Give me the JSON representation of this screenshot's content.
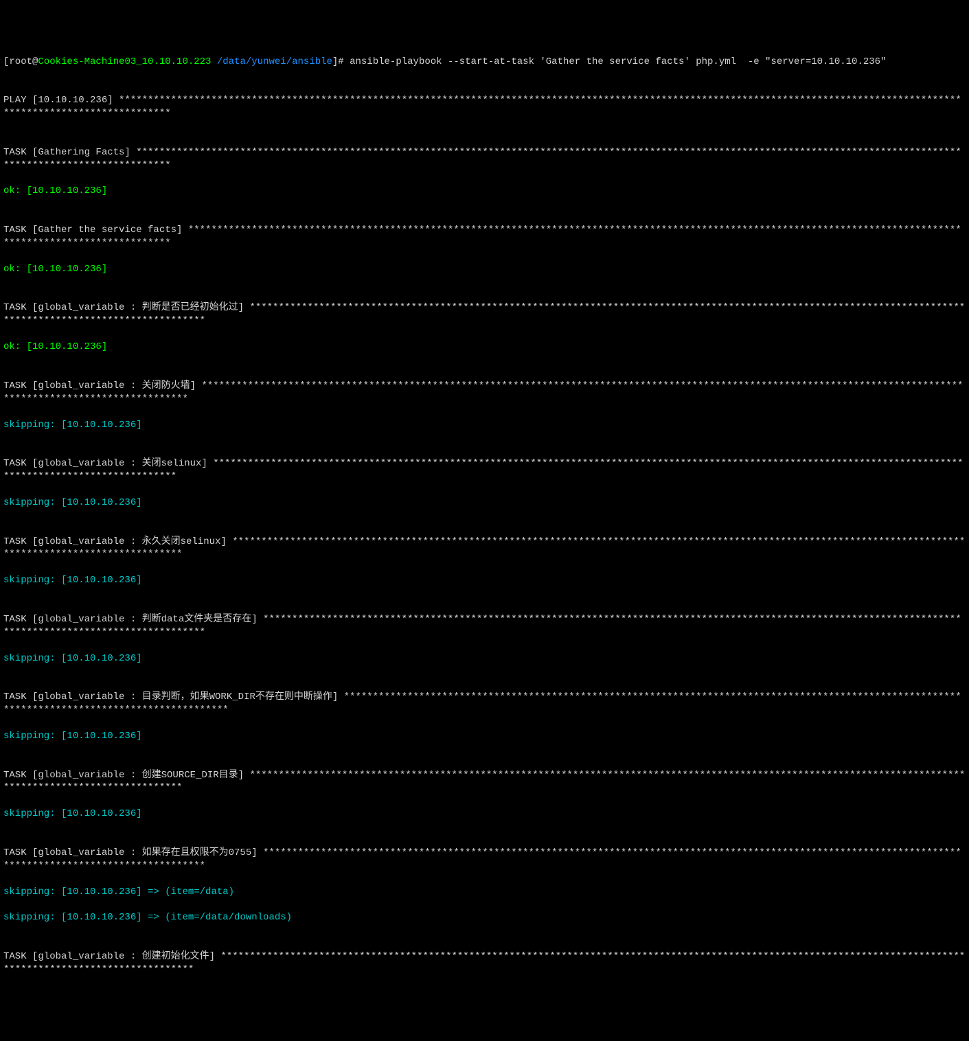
{
  "prompt": {
    "bracket_open": "[",
    "user_host": "root@",
    "machine": "Cookies-Machine03_10.10.10.223",
    "space": " ",
    "path": "/data/yunwei/ansible",
    "bracket_close": "]# ",
    "command": "ansible-playbook --start-at-task 'Gather the service facts' php.yml  -e \"server=10.10.10.236\""
  },
  "lines": {
    "play": "PLAY [10.10.10.236] *******************************************************************************************************************************************************************************",
    "blank1": "",
    "task_gather_facts": "TASK [Gathering Facts] ****************************************************************************************************************************************************************************",
    "ok1": "ok: [10.10.10.236]",
    "blank2": "",
    "task_service_facts": "TASK [Gather the service facts] *******************************************************************************************************************************************************************",
    "ok2": "ok: [10.10.10.236]",
    "blank3": "",
    "task_init": "TASK [global_variable : 判断是否已经初始化过] ***************************************************************************************************************************************************************",
    "ok3": "ok: [10.10.10.236]",
    "blank4": "",
    "task_firewall": "TASK [global_variable : 关闭防火墙] ********************************************************************************************************************************************************************",
    "skip1": "skipping: [10.10.10.236]",
    "blank5": "",
    "task_selinux": "TASK [global_variable : 关闭selinux] ****************************************************************************************************************************************************************",
    "skip2": "skipping: [10.10.10.236]",
    "blank6": "",
    "task_perm_selinux": "TASK [global_variable : 永久关闭selinux] **************************************************************************************************************************************************************",
    "skip3": "skipping: [10.10.10.236]",
    "blank7": "",
    "task_data_folder": "TASK [global_variable : 判断data文件夹是否存在] ************************************************************************************************************************************************************",
    "skip4": "skipping: [10.10.10.236]",
    "blank8": "",
    "task_workdir": "TASK [global_variable : 目录判断，如果WORK_DIR不存在则中断操作] **************************************************************************************************************************************************",
    "skip5": "skipping: [10.10.10.236]",
    "blank9": "",
    "task_sourcedir": "TASK [global_variable : 创建SOURCE_DIR目录] ***********************************************************************************************************************************************************",
    "skip6": "skipping: [10.10.10.236]",
    "blank10": "",
    "task_perm": "TASK [global_variable : 如果存在且权限不为0755] ************************************************************************************************************************************************************",
    "skip7": "skipping: [10.10.10.236] => (item=/data) ",
    "skip8": "skipping: [10.10.10.236] => (item=/data/downloads) ",
    "blank11": "",
    "task_create_init": "TASK [global_variable : 创建初始化文件] ******************************************************************************************************************************************************************"
  }
}
